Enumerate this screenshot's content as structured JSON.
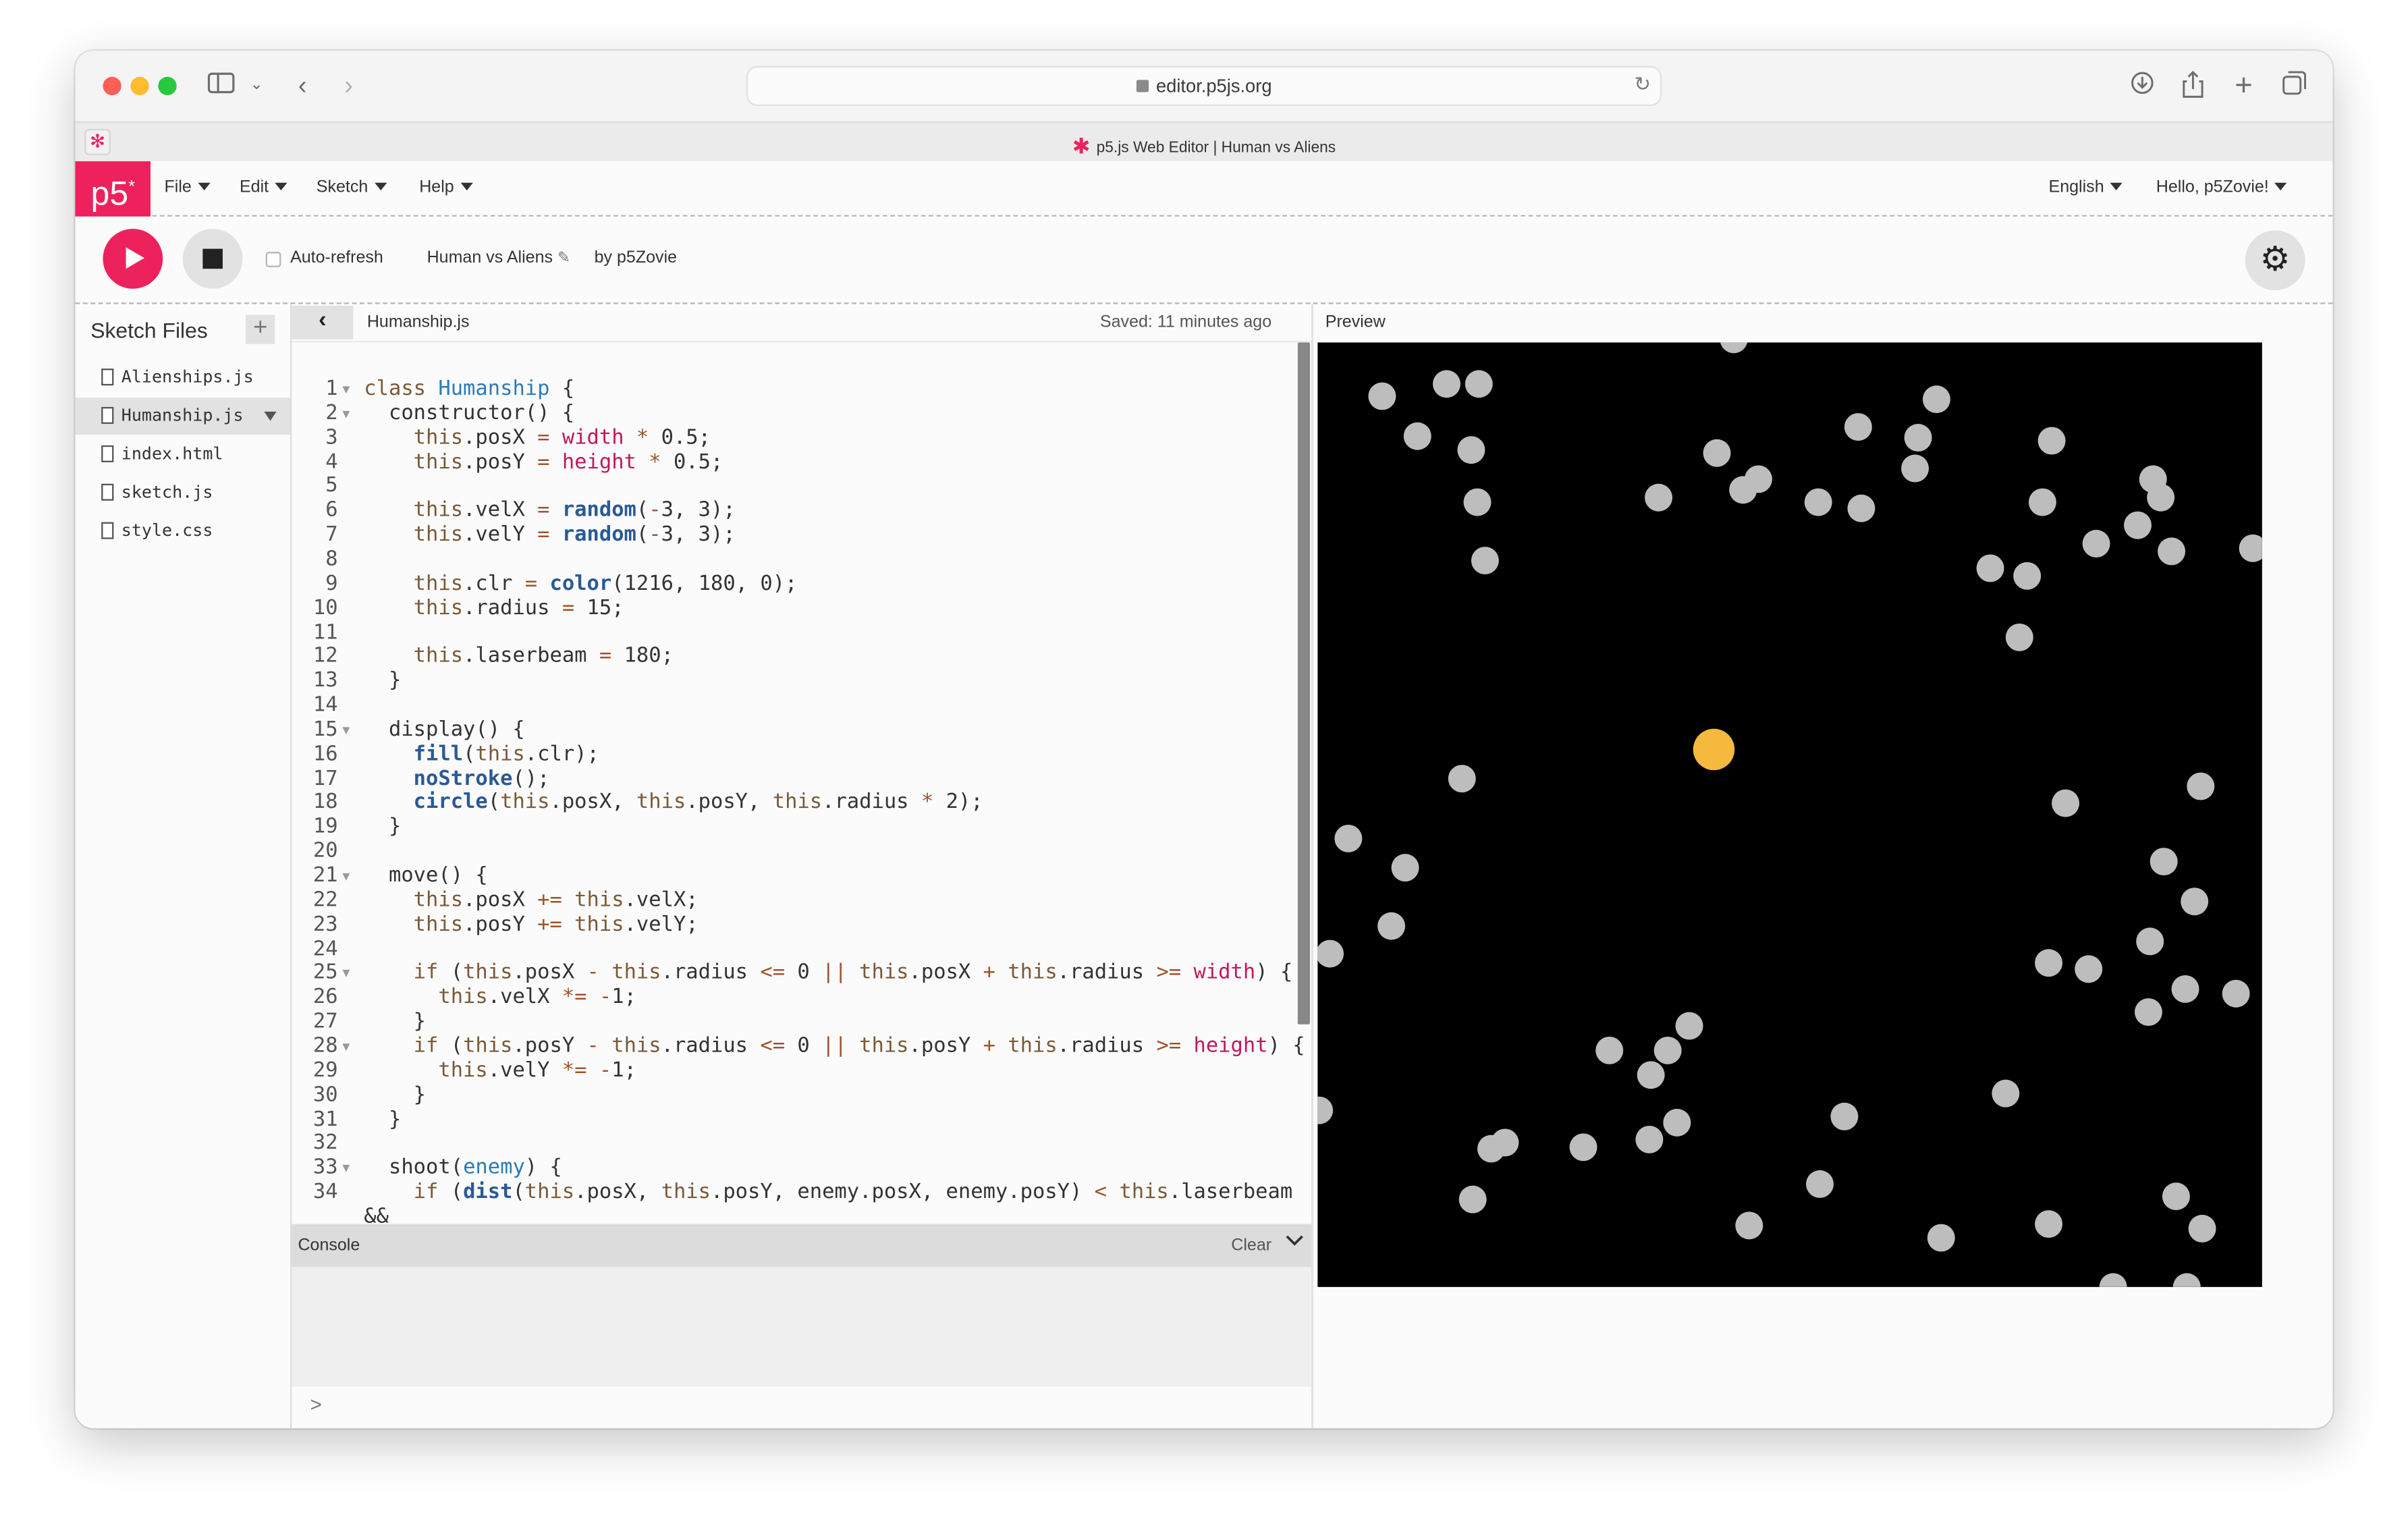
{
  "browser": {
    "url": "editor.p5js.org",
    "tab_title": "p5.js Web Editor | Human vs Aliens"
  },
  "nav": {
    "logo": "p5",
    "logo_sup": "*",
    "menus": [
      "File",
      "Edit",
      "Sketch",
      "Help"
    ],
    "language": "English",
    "user": "Hello, p5Zovie!"
  },
  "toolbar": {
    "auto_refresh": "Auto-refresh",
    "sketch_name": "Human vs Aliens",
    "author": "by p5Zovie"
  },
  "sidebar": {
    "title": "Sketch Files",
    "add": "+",
    "files": [
      "Alienships.js",
      "Humanship.js",
      "index.html",
      "sketch.js",
      "style.css"
    ],
    "active_file": "Humanship.js"
  },
  "editor": {
    "file": "Humanship.js",
    "saved": "Saved: 11 minutes ago",
    "lines": [
      {
        "n": "1",
        "fold": true,
        "text": "class Humanship {"
      },
      {
        "n": "2",
        "fold": true,
        "text": "  constructor() {"
      },
      {
        "n": "3",
        "fold": false,
        "text": "    this.posX = width * 0.5;"
      },
      {
        "n": "4",
        "fold": false,
        "text": "    this.posY = height * 0.5;"
      },
      {
        "n": "5",
        "fold": false,
        "text": ""
      },
      {
        "n": "6",
        "fold": false,
        "text": "    this.velX = random(-3, 3);"
      },
      {
        "n": "7",
        "fold": false,
        "text": "    this.velY = random(-3, 3);"
      },
      {
        "n": "8",
        "fold": false,
        "text": ""
      },
      {
        "n": "9",
        "fold": false,
        "text": "    this.clr = color(1216, 180, 0);"
      },
      {
        "n": "10",
        "fold": false,
        "text": "    this.radius = 15;"
      },
      {
        "n": "11",
        "fold": false,
        "text": ""
      },
      {
        "n": "12",
        "fold": false,
        "text": "    this.laserbeam = 180;"
      },
      {
        "n": "13",
        "fold": false,
        "text": "  }"
      },
      {
        "n": "14",
        "fold": false,
        "text": ""
      },
      {
        "n": "15",
        "fold": true,
        "text": "  display() {"
      },
      {
        "n": "16",
        "fold": false,
        "text": "    fill(this.clr);"
      },
      {
        "n": "17",
        "fold": false,
        "text": "    noStroke();"
      },
      {
        "n": "18",
        "fold": false,
        "text": "    circle(this.posX, this.posY, this.radius * 2);"
      },
      {
        "n": "19",
        "fold": false,
        "text": "  }"
      },
      {
        "n": "20",
        "fold": false,
        "text": ""
      },
      {
        "n": "21",
        "fold": true,
        "text": "  move() {"
      },
      {
        "n": "22",
        "fold": false,
        "text": "    this.posX += this.velX;"
      },
      {
        "n": "23",
        "fold": false,
        "text": "    this.posY += this.velY;"
      },
      {
        "n": "24",
        "fold": false,
        "text": ""
      },
      {
        "n": "25",
        "fold": true,
        "text": "    if (this.posX - this.radius <= 0 || this.posX + this.radius >= width) {"
      },
      {
        "n": "26",
        "fold": false,
        "text": "      this.velX *= -1;"
      },
      {
        "n": "27",
        "fold": false,
        "text": "    }"
      },
      {
        "n": "28",
        "fold": true,
        "text": "    if (this.posY - this.radius <= 0 || this.posY + this.radius >= height) {"
      },
      {
        "n": "29",
        "fold": false,
        "text": "      this.velY *= -1;"
      },
      {
        "n": "30",
        "fold": false,
        "text": "    }"
      },
      {
        "n": "31",
        "fold": false,
        "text": "  }"
      },
      {
        "n": "32",
        "fold": false,
        "text": ""
      },
      {
        "n": "33",
        "fold": true,
        "text": "  shoot(enemy) {"
      },
      {
        "n": "34",
        "fold": false,
        "text": "    if (dist(this.posX, this.posY, enemy.posX, enemy.posY) < this.laserbeam"
      },
      {
        "n": "",
        "fold": false,
        "text": "&&"
      }
    ]
  },
  "console": {
    "label": "Console",
    "clear": "Clear",
    "prompt": ">"
  },
  "preview": {
    "label": "Preview"
  },
  "colors": {
    "accent": "#ed225d",
    "human_ship": "#f5b93e",
    "aliens": "#bdbdbd",
    "canvas_bg": "#000000"
  }
}
